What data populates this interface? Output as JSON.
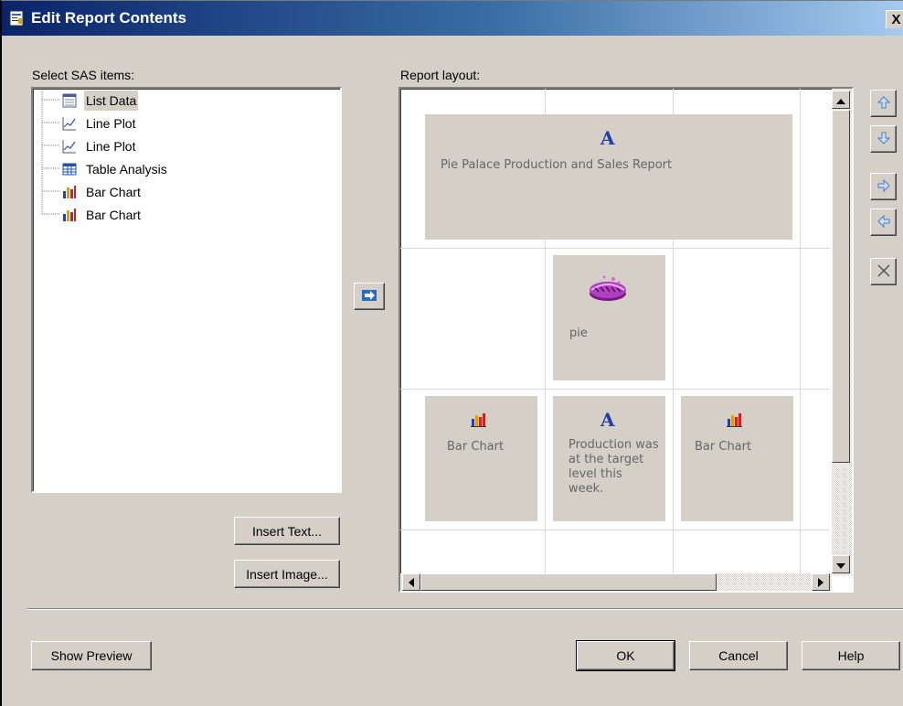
{
  "window": {
    "title": "Edit Report Contents",
    "close_glyph": "X"
  },
  "left_panel": {
    "label": "Select SAS items:",
    "items": [
      {
        "label": "List Data",
        "icon": "list-data-icon",
        "selected": true
      },
      {
        "label": "Line Plot",
        "icon": "line-plot-icon",
        "selected": false
      },
      {
        "label": "Line Plot",
        "icon": "line-plot-icon",
        "selected": false
      },
      {
        "label": "Table Analysis",
        "icon": "table-analysis-icon",
        "selected": false
      },
      {
        "label": "Bar Chart",
        "icon": "bar-chart-icon",
        "selected": false
      },
      {
        "label": "Bar Chart",
        "icon": "bar-chart-icon",
        "selected": false
      }
    ],
    "insert_text_button": "Insert Text...",
    "insert_image_button": "Insert Image..."
  },
  "right_panel": {
    "label": "Report layout:",
    "cells": {
      "title": {
        "glyph": "A",
        "text": "Pie Palace Production and Sales Report"
      },
      "image": {
        "text": "pie",
        "icon": "pie-image-icon"
      },
      "bar_left": {
        "text": "Bar Chart",
        "icon": "bar-chart-icon"
      },
      "text_mid": {
        "glyph": "A",
        "text": "Production was at the target level this week."
      },
      "bar_right": {
        "text": "Bar Chart",
        "icon": "bar-chart-icon"
      }
    }
  },
  "side_buttons": [
    "move-up",
    "move-down",
    "move-right",
    "move-left",
    "delete"
  ],
  "footer": {
    "show_preview_button": "Show Preview",
    "ok_button": "OK",
    "cancel_button": "Cancel",
    "help_button": "Help"
  },
  "colors": {
    "dialog_bg": "#d4d0c8",
    "title_gradient_start": "#0a246a",
    "title_gradient_end": "#a6caf0",
    "letter_glyph": "#1f3fa6",
    "cell_text": "#666666"
  }
}
